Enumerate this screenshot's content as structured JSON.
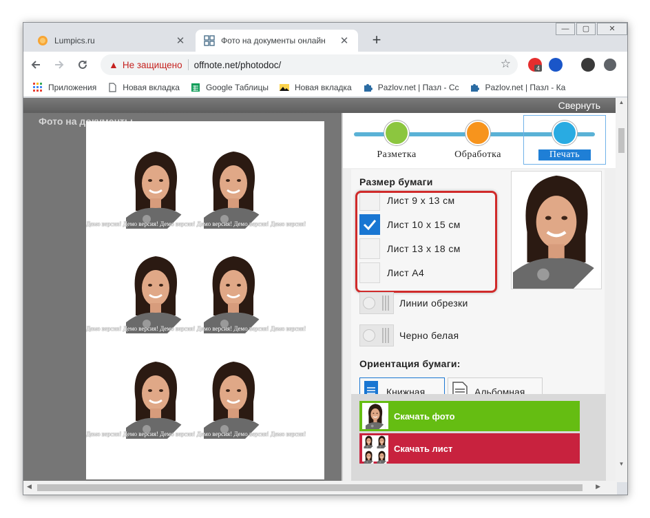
{
  "browser": {
    "tabs": [
      {
        "title": "Lumpics.ru",
        "favicon": "orange-circle-icon"
      },
      {
        "title": "Фото на документы онлайн",
        "favicon": "photo-grid-icon"
      }
    ],
    "close_glyph": "✕",
    "new_tab_glyph": "+",
    "window_controls": [
      "—",
      "▢",
      "✕"
    ],
    "security_label": "Не защищено",
    "url": "offnote.net/photodoc/",
    "extension_badge": "4"
  },
  "bookmarks": [
    {
      "label": "Приложения",
      "icon": "apps-grid-icon"
    },
    {
      "label": "Новая вкладка",
      "icon": "page-icon"
    },
    {
      "label": "Google Таблицы",
      "icon": "sheets-icon"
    },
    {
      "label": "Новая вкладка",
      "icon": "image-icon"
    },
    {
      "label": "Pazlov.net | Пазл - Сс",
      "icon": "puzzle-icon"
    },
    {
      "label": "Pazlov.net | Пазл - Ка",
      "icon": "puzzle-icon"
    }
  ],
  "app": {
    "collapse_label": "Свернуть",
    "left_header": "Фото на документы",
    "watermark": "Демо версия! Демо версия! Демо версия! Демо версия! Демо версия! Демо версия!",
    "steps": [
      {
        "label": "Разметка",
        "icon": "crop-icon",
        "color": "#8cc63f"
      },
      {
        "label": "Обработка",
        "icon": "sliders-icon",
        "color": "#f7941d"
      },
      {
        "label": "Печать",
        "icon": "printer-icon",
        "color": "#29abe2"
      }
    ],
    "paper_size_title": "Размер бумаги",
    "paper_sizes": [
      {
        "label": "Лист 9 x 13 см",
        "checked": false
      },
      {
        "label": "Лист 10 x 15 см",
        "checked": true
      },
      {
        "label": "Лист 13 x 18 см",
        "checked": false
      },
      {
        "label": "Лист A4",
        "checked": false
      }
    ],
    "toggles": [
      {
        "label": "Линии обрезки",
        "on": false
      },
      {
        "label": "Черно белая",
        "on": false
      }
    ],
    "orientation_title": "Ориентация бумаги:",
    "orientations": [
      {
        "label": "Книжная",
        "selected": true
      },
      {
        "label": "Альбомная",
        "selected": false
      }
    ],
    "download_photo_label": "Скачать фото",
    "download_sheet_label": "Скачать лист",
    "colors": {
      "download_photo": "#65bd12",
      "download_sheet": "#c8223e",
      "highlight": "#d02a2a",
      "accent": "#1976d2"
    }
  }
}
